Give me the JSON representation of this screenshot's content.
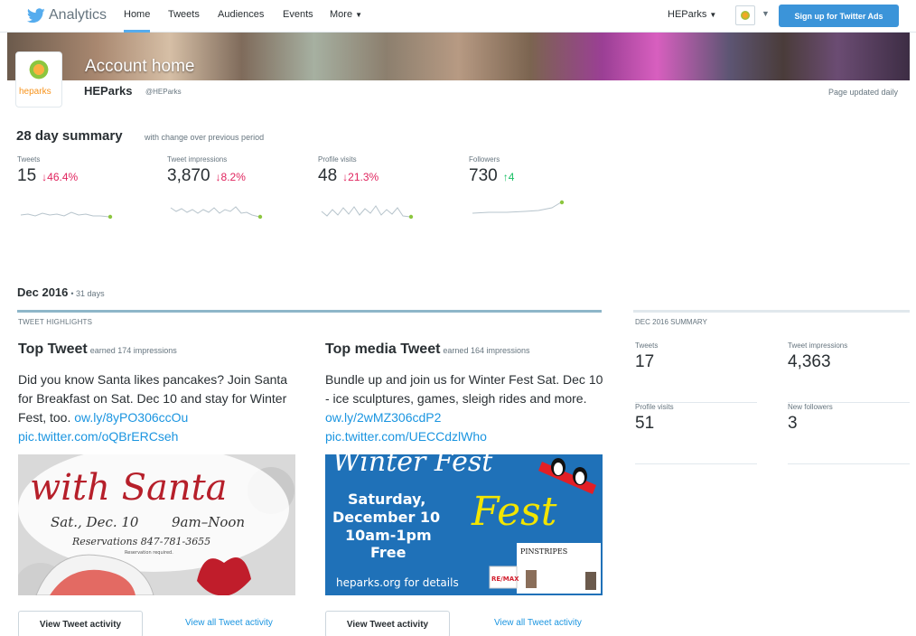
{
  "nav": {
    "brand": "Analytics",
    "links": [
      "Home",
      "Tweets",
      "Audiences",
      "Events",
      "More"
    ],
    "account": "HEParks",
    "ads_button": "Sign up for Twitter Ads"
  },
  "header": {
    "banner_title": "Account home",
    "logo_text": "heparks",
    "account_name": "HEParks",
    "handle": "@HEParks",
    "updated": "Page updated daily"
  },
  "summary": {
    "title": "28 day summary",
    "subtitle": "with change over previous period",
    "stats": [
      {
        "label": "Tweets",
        "value": "15",
        "change": "↓46.4%",
        "direction": "down"
      },
      {
        "label": "Tweet impressions",
        "value": "3,870",
        "change": "↓8.2%",
        "direction": "down"
      },
      {
        "label": "Profile visits",
        "value": "48",
        "change": "↓21.3%",
        "direction": "down"
      },
      {
        "label": "Followers",
        "value": "730",
        "change": "↑4",
        "direction": "up"
      }
    ]
  },
  "month": {
    "title": "Dec 2016",
    "days": "• 31 days",
    "highlights_label": "TWEET HIGHLIGHTS",
    "top_tweet": {
      "title": "Top Tweet",
      "earned": "earned 174 impressions",
      "text": "Did you know Santa likes pancakes? Join Santa for Breakfast on Sat. Dec 10 and stay for Winter Fest, too.",
      "link1": "ow.ly/8yPO306ccOu",
      "link2": "pic.twitter.com/oQBrERCseh"
    },
    "top_media": {
      "title": "Top media Tweet",
      "earned": "earned 164 impressions",
      "text": "Bundle up and join us for Winter Fest Sat. Dec 10 - ice sculptures, games, sleigh rides and more.",
      "link1": "ow.ly/2wMZ306cdP2",
      "link2": "pic.twitter.com/UECCdzlWho"
    },
    "santa_image": {
      "line1": "with Santa",
      "date": "Sat., Dec. 10",
      "time": "9am–Noon",
      "reservations": "Reservations 847-781-3655",
      "required": "Reservation required."
    },
    "fest_image": {
      "title": "Winter Fest",
      "line1": "Saturday,",
      "line2": "December 10",
      "line3": "10am-1pm",
      "line4": "Free",
      "footer": "heparks.org for details",
      "sponsor": "PINSTRIPES",
      "remax": "RE/MAX"
    },
    "view_button": "View Tweet activity",
    "view_all": "View all Tweet activity"
  },
  "right_summary": {
    "label": "DEC 2016 SUMMARY",
    "cells": [
      {
        "label": "Tweets",
        "value": "17"
      },
      {
        "label": "Tweet impressions",
        "value": "4,363"
      },
      {
        "label": "Profile visits",
        "value": "51"
      },
      {
        "label": "New followers",
        "value": "3"
      }
    ]
  },
  "colors": {
    "accent": "#1b95e0",
    "down": "#e0245e",
    "up": "#17bf63",
    "ads_button": "#3b94d9"
  }
}
